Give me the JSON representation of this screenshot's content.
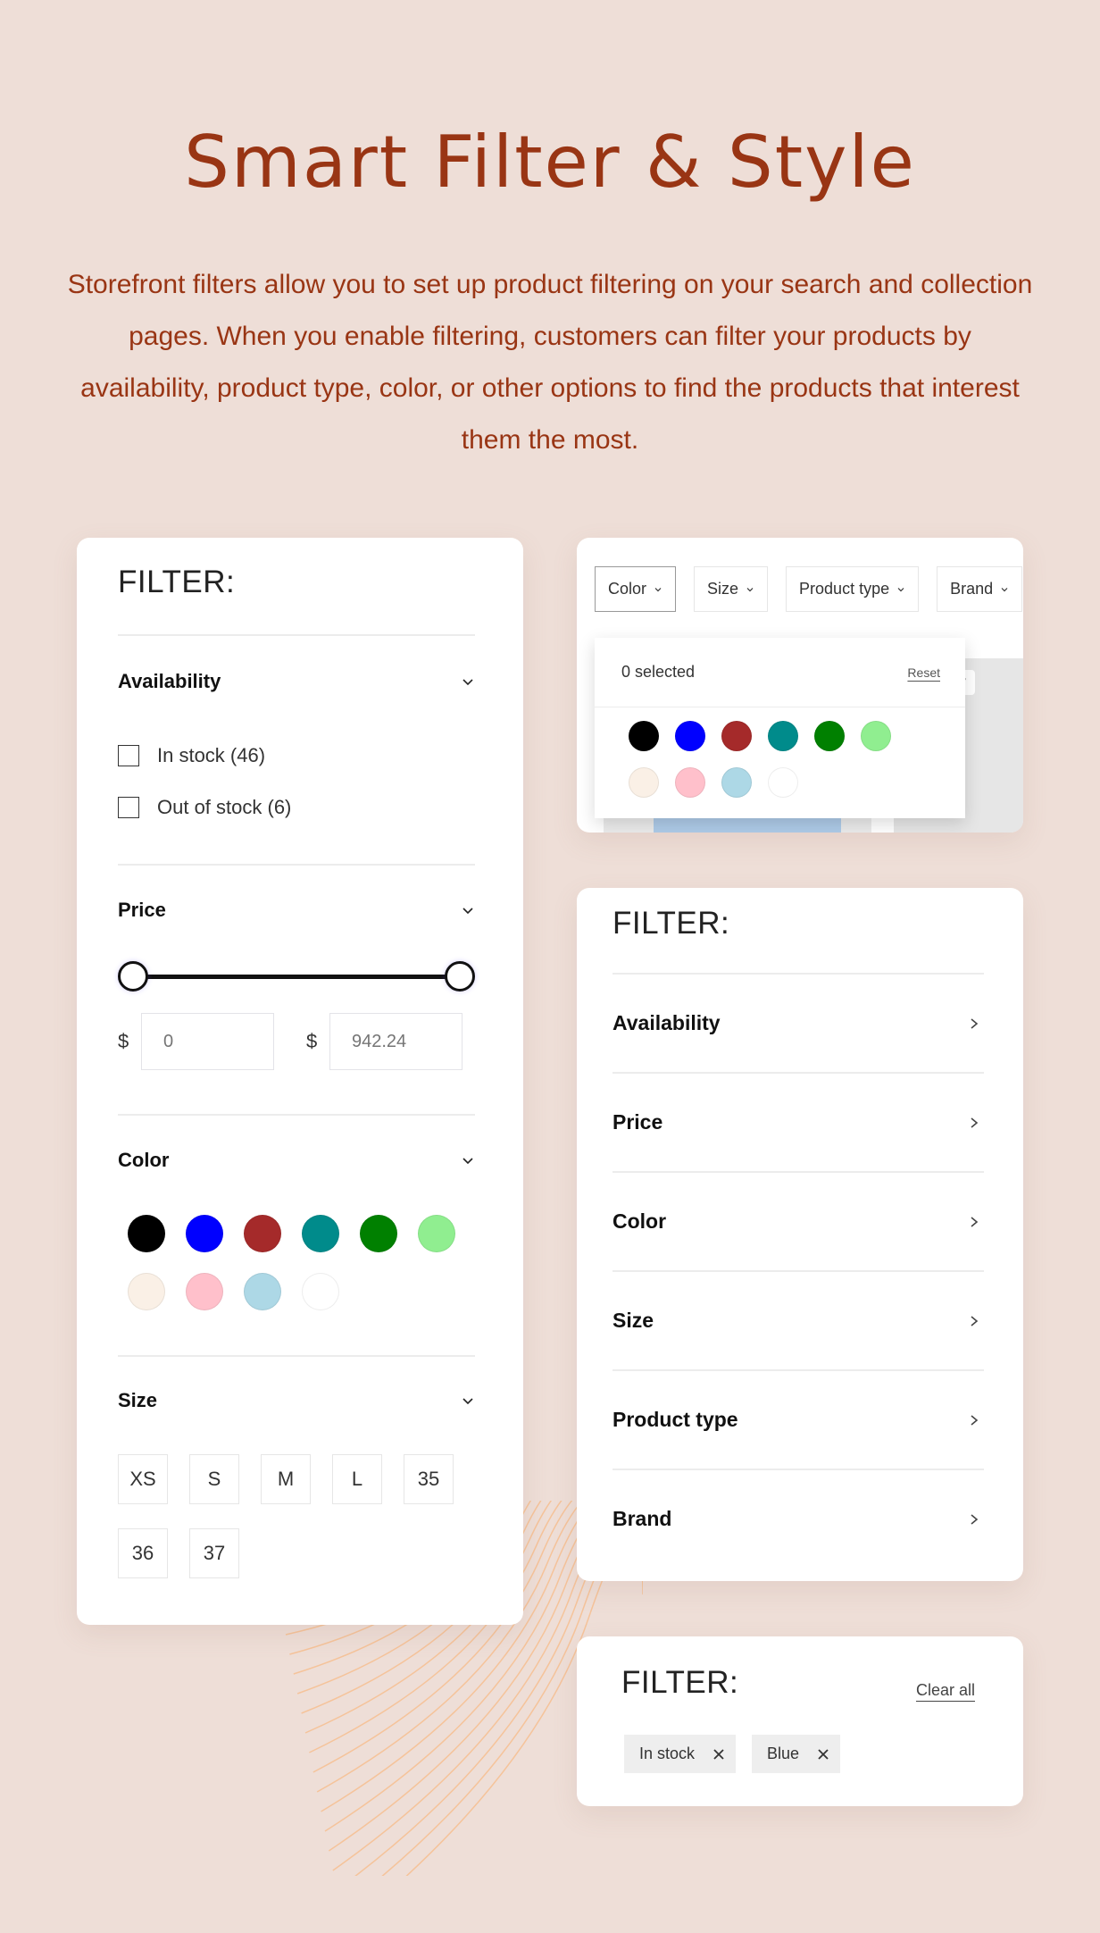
{
  "hero": {
    "title": "Smart Filter & Style",
    "description": "Storefront filters allow you to set up product filtering on your search and collection pages. When you enable filtering, customers can filter your products by availability, product type, color, or other options to find the products that interest them the most."
  },
  "colors": {
    "background": "#EEDED7",
    "accent": "#993514",
    "wave_lines": "#F5C39A"
  },
  "swatch_colors": [
    {
      "name": "Black",
      "hex": "#000000"
    },
    {
      "name": "Blue",
      "hex": "#0000FF"
    },
    {
      "name": "Brown",
      "hex": "#A52A2A"
    },
    {
      "name": "Teal",
      "hex": "#008B8B"
    },
    {
      "name": "Green",
      "hex": "#008000"
    },
    {
      "name": "Light green",
      "hex": "#90EE90"
    },
    {
      "name": "Linen",
      "hex": "#FAF0E6"
    },
    {
      "name": "Pink",
      "hex": "#FFC0CB"
    },
    {
      "name": "Light blue",
      "hex": "#ADD8E6"
    },
    {
      "name": "White",
      "hex": "#FFFFFF"
    }
  ],
  "left_panel": {
    "title": "FILTER:",
    "availability": {
      "label": "Availability",
      "options": [
        {
          "label": "In stock (46)",
          "checked": false
        },
        {
          "label": "Out of stock (6)",
          "checked": false
        }
      ]
    },
    "price": {
      "label": "Price",
      "currency": "$",
      "min_value": "0",
      "max_value": "942.24",
      "range_min_fraction": 0,
      "range_max_fraction": 1
    },
    "color": {
      "label": "Color"
    },
    "size": {
      "label": "Size",
      "options": [
        "XS",
        "S",
        "M",
        "L",
        "35",
        "36",
        "37"
      ]
    }
  },
  "horizontal_filter": {
    "pills": [
      {
        "label": "Color",
        "active": true
      },
      {
        "label": "Size",
        "active": false
      },
      {
        "label": "Product type",
        "active": false
      },
      {
        "label": "Brand",
        "active": false
      }
    ],
    "dropdown": {
      "selected_text": "0 selected",
      "reset_label": "Reset"
    },
    "badge_partial": "w"
  },
  "drawer_filter": {
    "title": "FILTER:",
    "items": [
      "Availability",
      "Price",
      "Color",
      "Size",
      "Product type",
      "Brand"
    ]
  },
  "active_filters": {
    "title": "FILTER:",
    "clear_all_label": "Clear all",
    "chips": [
      "In stock",
      "Blue"
    ]
  }
}
